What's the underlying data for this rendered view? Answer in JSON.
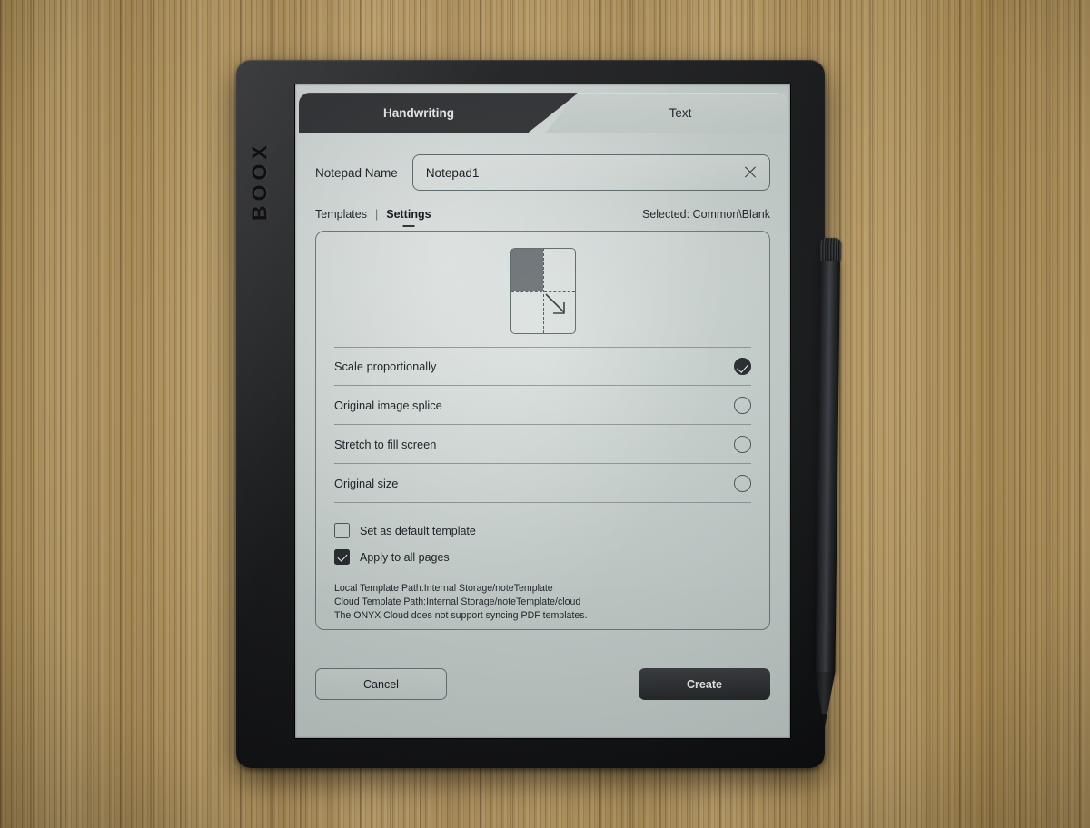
{
  "device": {
    "brand": "BOOX"
  },
  "tabs": [
    {
      "label": "Handwriting",
      "active": true
    },
    {
      "label": "Text",
      "active": false
    }
  ],
  "name_row": {
    "label": "Notepad Name",
    "value": "Notepad1",
    "placeholder": "Notepad1",
    "clear_icon": "close-icon"
  },
  "subnav": {
    "templates_label": "Templates",
    "divider": "|",
    "settings_label": "Settings",
    "selected_label": "Selected: Common\\Blank"
  },
  "preview": {
    "icon_name": "scale-proportionally-preview-icon"
  },
  "options": [
    {
      "label": "Scale proportionally",
      "selected": true
    },
    {
      "label": "Original image splice",
      "selected": false
    },
    {
      "label": "Stretch to fill screen",
      "selected": false
    },
    {
      "label": "Original size",
      "selected": false
    }
  ],
  "checkboxes": [
    {
      "label": "Set as default template",
      "checked": false
    },
    {
      "label": "Apply to all pages",
      "checked": true
    }
  ],
  "paths": [
    "Local Template Path:Internal Storage/noteTemplate",
    "Cloud Template Path:Internal Storage/noteTemplate/cloud",
    "The ONYX Cloud does not support syncing PDF templates."
  ],
  "footer": {
    "cancel_label": "Cancel",
    "create_label": "Create"
  },
  "colors": {
    "screen_bg": "#c8d2cf",
    "active_tab_bg": "#313336",
    "accent_dark": "#24282c",
    "wood_base": "#c2a268"
  }
}
